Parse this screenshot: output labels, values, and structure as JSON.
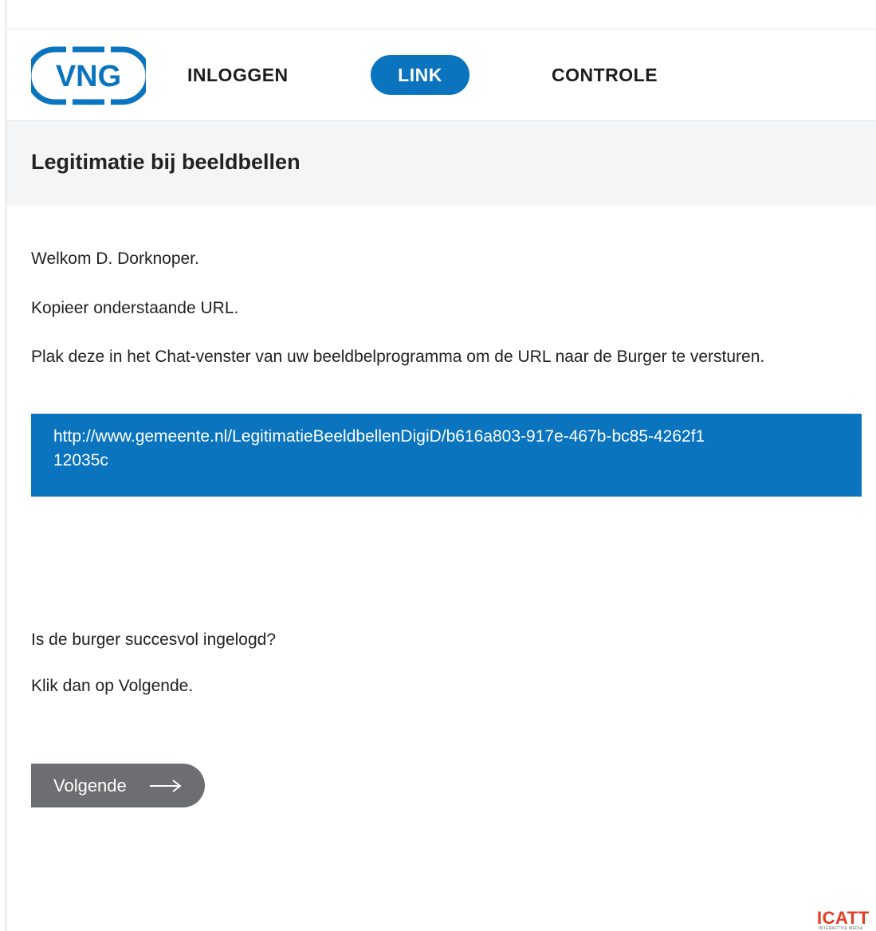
{
  "brand": {
    "logo_text": "VNG",
    "logo_color": "#0a74bf"
  },
  "nav": {
    "items": [
      {
        "label": "INLOGGEN",
        "active": false
      },
      {
        "label": "LINK",
        "active": true
      },
      {
        "label": "CONTROLE",
        "active": false
      }
    ],
    "active_color": "#0a74bf"
  },
  "page": {
    "title": "Legitimatie bij beeldbellen"
  },
  "content": {
    "welcome": "Welkom D. Dorknoper.",
    "copy_instruction": "Kopieer onderstaande URL.",
    "paste_instruction": "Plak deze in het Chat-venster van uw beeldbelprogramma om de URL naar de Burger te versturen.",
    "url": "http://www.gemeente.nl/LegitimatieBeeldbellenDigiD/b616a803-917e-467b-bc85-4262f112035c",
    "login_question": "Is de burger succesvol ingelogd?",
    "next_instruction": "Klik dan op Volgende."
  },
  "actions": {
    "next_label": "Volgende",
    "next_icon": "arrow-right-icon"
  },
  "footer": {
    "vendor_logo": "ICATT",
    "vendor_tagline": "INTERACTIVE MEDIA",
    "vendor_color": "#e63b25"
  }
}
